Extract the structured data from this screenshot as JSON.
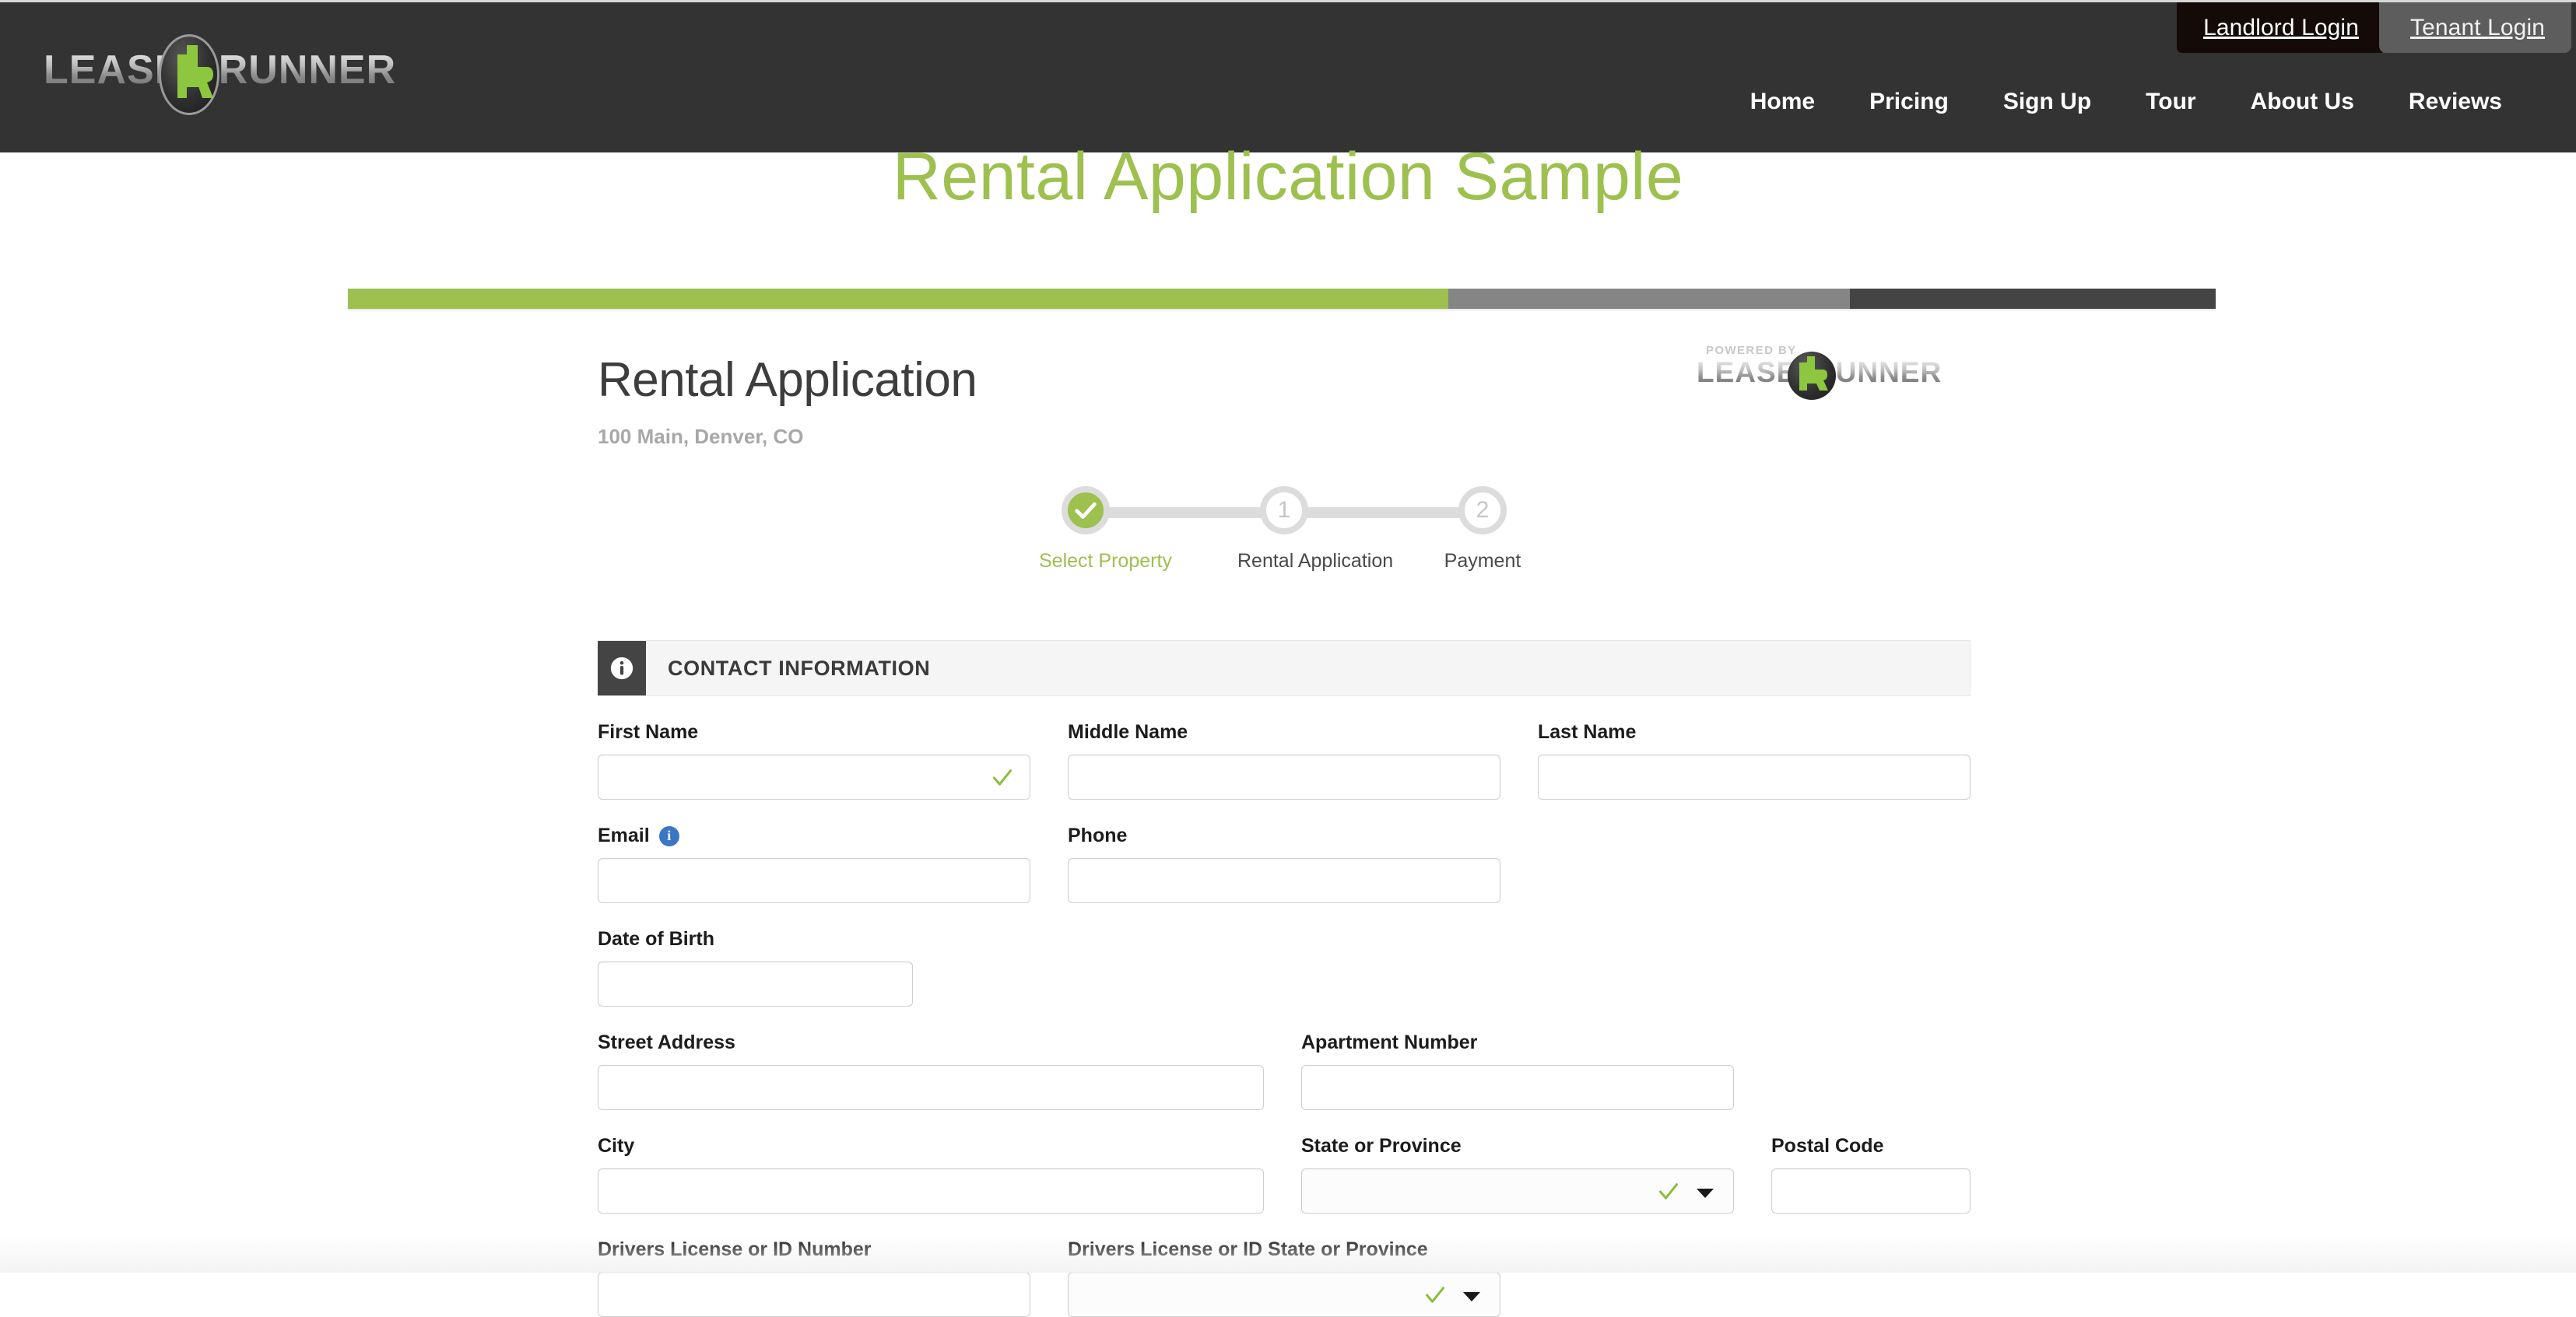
{
  "header": {
    "logo_left": "LEASE",
    "logo_right": "RUNNER",
    "login_buttons": [
      {
        "label": "Landlord Login",
        "style": "dark"
      },
      {
        "label": "Tenant Login",
        "style": "gray"
      }
    ],
    "nav": [
      {
        "label": "Home"
      },
      {
        "label": "Pricing"
      },
      {
        "label": "Sign Up"
      },
      {
        "label": "Tour"
      },
      {
        "label": "About Us"
      },
      {
        "label": "Reviews"
      }
    ]
  },
  "page": {
    "title": "Rental Application Sample"
  },
  "progress": {
    "green_pct": "58.9%",
    "gray_pct": "21.5%",
    "dark_pct": "19.6%",
    "green_color": "#9dc04f",
    "gray_color": "#858585",
    "dark_color": "#444444"
  },
  "form": {
    "heading": "Rental Application",
    "subheading": "100 Main, Denver, CO",
    "powered_by_label": "POWERED BY",
    "powered_logo_left": "LEASE",
    "powered_logo_right": "RUNNER",
    "steps": [
      {
        "marker": "✓",
        "caption": "Select Property",
        "state": "done"
      },
      {
        "marker": "1",
        "caption": "Rental Application",
        "state": "upcoming"
      },
      {
        "marker": "2",
        "caption": "Payment",
        "state": "upcoming"
      }
    ],
    "section": {
      "icon": "info-icon",
      "title": "CONTACT INFORMATION"
    },
    "fields": {
      "first_name": {
        "label": "First Name",
        "value": "",
        "placeholder": ""
      },
      "middle_name": {
        "label": "Middle Name",
        "value": "",
        "placeholder": ""
      },
      "last_name": {
        "label": "Last Name",
        "value": "",
        "placeholder": ""
      },
      "email": {
        "label": "Email",
        "value": "",
        "placeholder": ""
      },
      "phone": {
        "label": "Phone",
        "value": "",
        "placeholder": ""
      },
      "date_of_birth": {
        "label": "Date of Birth",
        "value": "",
        "placeholder": ""
      },
      "street_address": {
        "label": "Street Address",
        "value": "",
        "placeholder": ""
      },
      "apartment_number": {
        "label": "Apartment Number",
        "value": "",
        "placeholder": ""
      },
      "city": {
        "label": "City",
        "value": "",
        "placeholder": ""
      },
      "state_or_province": {
        "label": "State or Province",
        "value": "",
        "placeholder": ""
      },
      "postal_code": {
        "label": "Postal Code",
        "value": "",
        "placeholder": ""
      },
      "drivers_license_number": {
        "label": "Drivers License or ID Number",
        "value": "",
        "placeholder": ""
      },
      "drivers_license_state": {
        "label": "Drivers License or ID State or Province",
        "value": "",
        "placeholder": ""
      }
    },
    "info_icon_glyph": "i"
  },
  "colors": {
    "brand_green": "#9dc04f",
    "header_dark": "#333333",
    "info_blue": "#3a76c4"
  }
}
